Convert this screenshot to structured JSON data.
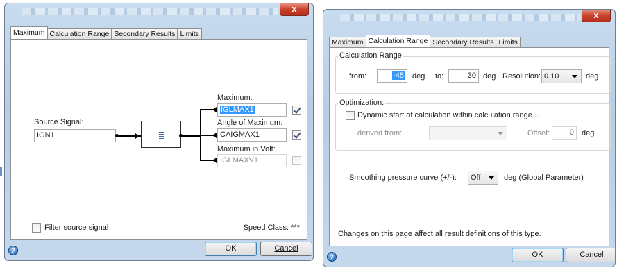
{
  "left_dialog": {
    "close_label": "x",
    "tabs": [
      "Maximum",
      "Calculation Range",
      "Secondary Results",
      "Limits"
    ],
    "source_signal_label": "Source Signal:",
    "source_signal_value": "IGN1",
    "maximum_label": "Maximum:",
    "maximum_value": "IGLMAX1",
    "maximum_checked": true,
    "angle_label": "Angle of Maximum:",
    "angle_value": "CAIGMAX1",
    "angle_checked": true,
    "volt_label": "Maximum in Volt:",
    "volt_value": "IGLMAXV1",
    "volt_checked": false,
    "filter_label": "Filter source signal",
    "speed_class_label": "Speed Class: ***",
    "help_label": "?",
    "ok_label": "OK",
    "cancel_label": "Cancel"
  },
  "right_dialog": {
    "close_label": "x",
    "tabs": [
      "Maximum",
      "Calculation Range",
      "Secondary Results",
      "Limits"
    ],
    "range_group_title": "Calculation Range",
    "from_label": "from:",
    "from_value": "-45",
    "deg_label": "deg",
    "to_label": "to:",
    "to_value": "30",
    "resolution_label": "Resolution:",
    "resolution_value": "0.10",
    "optimization_group_title": "Optimization:",
    "dynamic_start_label": "Dynamic start of calculation within calculation range...",
    "derived_from_label": "derived from:",
    "offset_label": "Offset:",
    "offset_value": "0",
    "smoothing_label": "Smoothing pressure curve (+/-):",
    "smoothing_value": "Off",
    "smoothing_suffix": "deg (Global Parameter)",
    "changes_note": "Changes on this page affect all result definitions of this type.",
    "help_label": "?",
    "ok_label": "OK",
    "cancel_label": "Cancel"
  }
}
